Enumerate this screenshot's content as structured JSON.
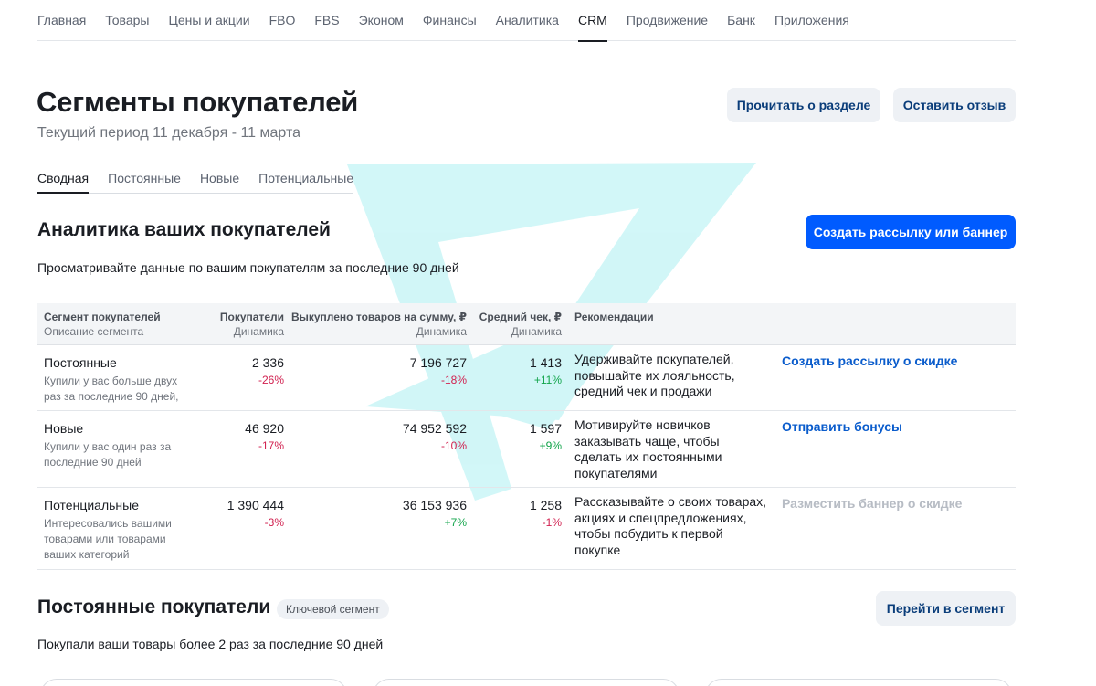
{
  "nav": {
    "items": [
      {
        "label": "Главная",
        "name": "nav-item-main"
      },
      {
        "label": "Товары",
        "name": "nav-item-products"
      },
      {
        "label": "Цены и акции",
        "name": "nav-item-prices"
      },
      {
        "label": "FBO",
        "name": "nav-item-fbo"
      },
      {
        "label": "FBS",
        "name": "nav-item-fbs"
      },
      {
        "label": "Эконом",
        "name": "nav-item-econom"
      },
      {
        "label": "Финансы",
        "name": "nav-item-finance"
      },
      {
        "label": "Аналитика",
        "name": "nav-item-analytics"
      },
      {
        "label": "CRM",
        "name": "nav-item-crm"
      },
      {
        "label": "Продвижение",
        "name": "nav-item-promotion"
      },
      {
        "label": "Банк",
        "name": "nav-item-bank"
      },
      {
        "label": "Приложения",
        "name": "nav-item-apps"
      }
    ],
    "active": "CRM"
  },
  "header": {
    "title": "Сегменты покупателей",
    "subtitle": "Текущий период 11 декабря - 11 марта",
    "read_button": "Прочитать о разделе",
    "review_button": "Оставить отзыв"
  },
  "tabs": {
    "items": [
      {
        "label": "Сводная",
        "name": "tab-summary"
      },
      {
        "label": "Постоянные",
        "name": "tab-regular"
      },
      {
        "label": "Новые",
        "name": "tab-new"
      },
      {
        "label": "Потенциальные",
        "name": "tab-potential"
      }
    ],
    "active": "Сводная"
  },
  "analytics": {
    "title": "Аналитика ваших покупателей",
    "create_button": "Создать рассылку или баннер",
    "description": "Просматривайте данные по вашим покупателям за последние 90 дней"
  },
  "table": {
    "headers": {
      "segment": {
        "title": "Сегмент покупателей",
        "sub": "Описание сегмента"
      },
      "buyers": {
        "title": "Покупатели",
        "sub": "Динамика"
      },
      "bought": {
        "title": "Выкуплено товаров на сумму, ₽",
        "sub": "Динамика"
      },
      "avg": {
        "title": "Средний чек, ₽",
        "sub": "Динамика"
      },
      "recommendations": {
        "title": "Рекомендации"
      }
    },
    "rows": [
      {
        "segment": "Постоянные",
        "description": "Купили у вас больше двух раз за последние 90 дней,",
        "buyers": "2 336",
        "buyers_dyn": "-26%",
        "bought": "7 196 727",
        "bought_dyn": "-18%",
        "avg": "1 413",
        "avg_dyn": "+11%",
        "recommendation": "Удерживайте покупателей, повышайте их лояльность, средний чек и продажи",
        "action": "Создать рассылку о скидке",
        "action_enabled": true
      },
      {
        "segment": "Новые",
        "description": "Купили у вас один раз за последние 90 дней",
        "buyers": "46 920",
        "buyers_dyn": "-17%",
        "bought": "74 952 592",
        "bought_dyn": "-10%",
        "avg": "1 597",
        "avg_dyn": "+9%",
        "recommendation": "Мотивируйте новичков заказывать чаще, чтобы сделать их постоянными покупателями",
        "action": "Отправить бонусы",
        "action_enabled": true
      },
      {
        "segment": "Потенциальные",
        "description": "Интересовались вашими товарами или товарами ваших категорий",
        "buyers": "1 390 444",
        "buyers_dyn": "-3%",
        "bought": "36 153 936",
        "bought_dyn": "+7%",
        "avg": "1 258",
        "avg_dyn": "-1%",
        "recommendation": "Рассказывайте о своих товарах, акциях и спецпредложениях, чтобы побудить к первой покупке",
        "action": "Разместить баннер о скидке",
        "action_enabled": false
      }
    ]
  },
  "regular_section": {
    "title": "Постоянные покупатели",
    "badge": "Ключевой сегмент",
    "goto_button": "Перейти в сегмент",
    "description": "Покупали ваши товары более 2 раз за последние 90 дней"
  },
  "colors": {
    "accent": "#005bff",
    "link": "#0a5ccc",
    "negative": "#d1204f",
    "positive": "#11a44a",
    "watermark": "#7ee8ea"
  }
}
